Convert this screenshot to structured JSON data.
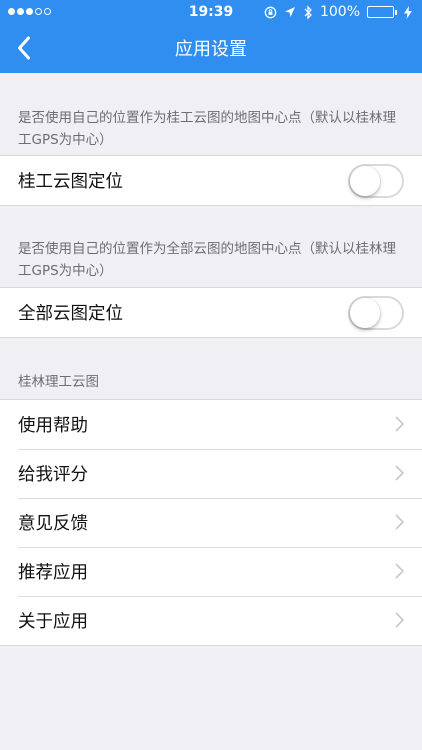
{
  "status_bar": {
    "time": "19:39",
    "battery": "100%",
    "signal_dots_filled": 3,
    "signal_dots_total": 5,
    "icons": [
      "signal-dots-icon",
      "lock-rotation-icon",
      "location-arrow-icon",
      "bluetooth-icon",
      "battery-icon",
      "charging-bolt-icon"
    ]
  },
  "navbar": {
    "title": "应用设置",
    "back_icon": "chevron-left-icon"
  },
  "guilin_location": {
    "note": "是否使用自己的位置作为桂工云图的地图中心点（默认以桂林理工GPS为中心）",
    "label": "桂工云图定位",
    "enabled": false
  },
  "all_location": {
    "note": "是否使用自己的位置作为全部云图的地图中心点（默认以桂林理工GPS为中心）",
    "label": "全部云图定位",
    "enabled": false
  },
  "about_section": {
    "header": "桂林理工云图",
    "items": [
      {
        "label": "使用帮助"
      },
      {
        "label": "给我评分"
      },
      {
        "label": "意见反馈"
      },
      {
        "label": "推荐应用"
      },
      {
        "label": "关于应用"
      }
    ]
  },
  "colors": {
    "accent": "#2f8ef0",
    "background": "#efeff4",
    "battery": "#46d35a",
    "secondary_text": "#6d6d72"
  }
}
